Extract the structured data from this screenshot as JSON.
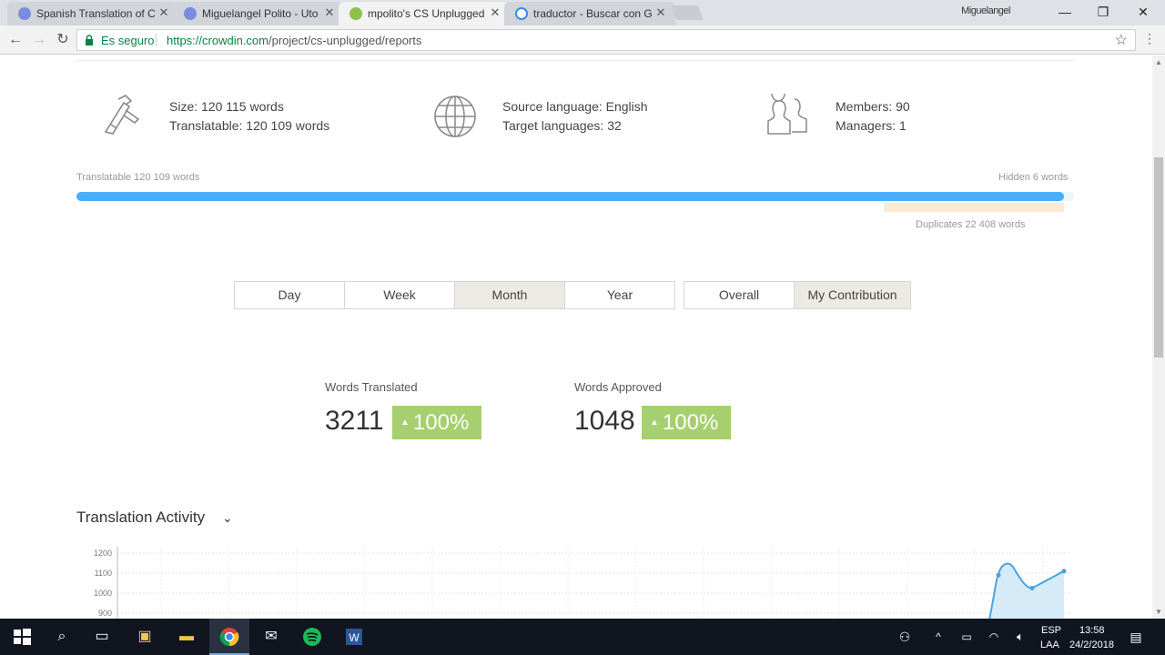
{
  "browser": {
    "tabs": [
      {
        "title": "Spanish Translation of C",
        "active": false,
        "favicon_color": "#7b8cde"
      },
      {
        "title": "Miguelangel Polito - Uto",
        "active": false,
        "favicon_color": "#7b8cde"
      },
      {
        "title": "mpolito's CS Unplugged",
        "active": true,
        "favicon_color": "#8bc34a"
      },
      {
        "title": "traductor - Buscar con G",
        "active": false,
        "favicon_color": "#4285f4"
      }
    ],
    "profile_name": "Miguelangel",
    "secure_label": "Es seguro",
    "url_host": "https://crowdin.com",
    "url_path": "/project/cs-unplugged/reports"
  },
  "stats": {
    "size": "Size: 120 115 words",
    "translatable": "Translatable: 120 109 words",
    "source_language": "Source language: English",
    "target_languages": "Target languages: 32",
    "members": "Members: 90",
    "managers": "Managers: 1"
  },
  "progress": {
    "left_label": "Translatable 120 109 words",
    "right_label": "Hidden 6 words",
    "duplicates_label": "Duplicates 22 408 words",
    "fill_fraction": 0.99
  },
  "period_tabs": [
    "Day",
    "Week",
    "Month",
    "Year"
  ],
  "period_active": "Month",
  "scope_tabs": [
    "Overall",
    "My Contribution"
  ],
  "scope_active": "My Contribution",
  "metrics": {
    "translated_label": "Words Translated",
    "translated_value": "3211",
    "translated_change": "100%",
    "approved_label": "Words Approved",
    "approved_value": "1048",
    "approved_change": "100%"
  },
  "section": {
    "title": "Translation Activity"
  },
  "chart_data": {
    "type": "area",
    "title": "",
    "y_ticks": [
      "1200",
      "1100",
      "1000",
      "900"
    ],
    "ylim": [
      900,
      1200
    ],
    "series": [
      {
        "values": [
          1090,
          1140,
          1025,
          1110
        ]
      }
    ],
    "color": "#4aa3df"
  },
  "taskbar": {
    "lang_top": "ESP",
    "lang_bottom": "LAA",
    "time": "13:58",
    "date": "24/2/2018"
  }
}
